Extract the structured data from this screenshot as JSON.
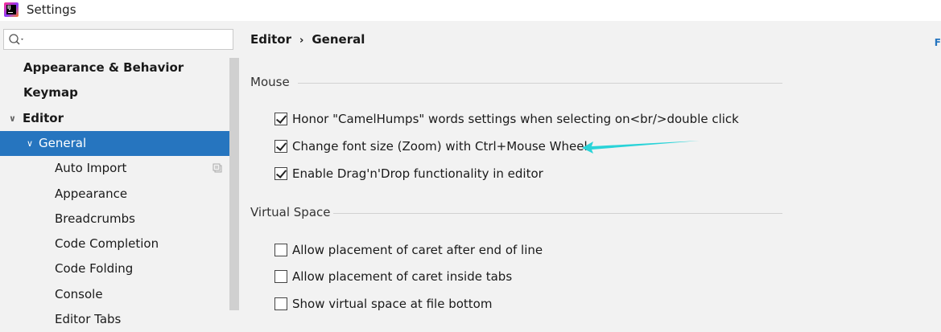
{
  "window": {
    "title": "Settings"
  },
  "sidebar": {
    "search": {
      "placeholder": "",
      "value": ""
    },
    "items": [
      {
        "label": "Appearance & Behavior",
        "level": 0,
        "expanded": false,
        "selected": false
      },
      {
        "label": "Keymap",
        "level": 0,
        "expanded": false,
        "selected": false
      },
      {
        "label": "Editor",
        "level": 0,
        "expanded": true,
        "selected": false
      },
      {
        "label": "General",
        "level": 1,
        "expanded": true,
        "selected": true
      },
      {
        "label": "Auto Import",
        "level": 2,
        "selected": false
      },
      {
        "label": "Appearance",
        "level": 2,
        "selected": false
      },
      {
        "label": "Breadcrumbs",
        "level": 2,
        "selected": false
      },
      {
        "label": "Code Completion",
        "level": 2,
        "selected": false
      },
      {
        "label": "Code Folding",
        "level": 2,
        "selected": false
      },
      {
        "label": "Console",
        "level": 2,
        "selected": false
      },
      {
        "label": "Editor Tabs",
        "level": 2,
        "selected": false
      }
    ]
  },
  "main": {
    "breadcrumb": {
      "parent": "Editor",
      "separator": "›",
      "current": "General"
    },
    "edge_text": "F",
    "sections": [
      {
        "title": "Mouse",
        "options": [
          {
            "label": "Honor \"CamelHumps\" words settings when selecting on<br/>double click",
            "checked": true
          },
          {
            "label": "Change font size (Zoom) with Ctrl+Mouse Wheel",
            "checked": true
          },
          {
            "label": "Enable Drag'n'Drop functionality in editor",
            "checked": true
          }
        ]
      },
      {
        "title": "Virtual Space",
        "options": [
          {
            "label": "Allow placement of caret after end of line",
            "checked": false
          },
          {
            "label": "Allow placement of caret inside tabs",
            "checked": false
          },
          {
            "label": "Show virtual space at file bottom",
            "checked": false
          }
        ]
      }
    ]
  },
  "colors": {
    "selection": "#2675bf",
    "annotation_arrow": "#2ad3d8",
    "background": "#f2f2f2"
  }
}
